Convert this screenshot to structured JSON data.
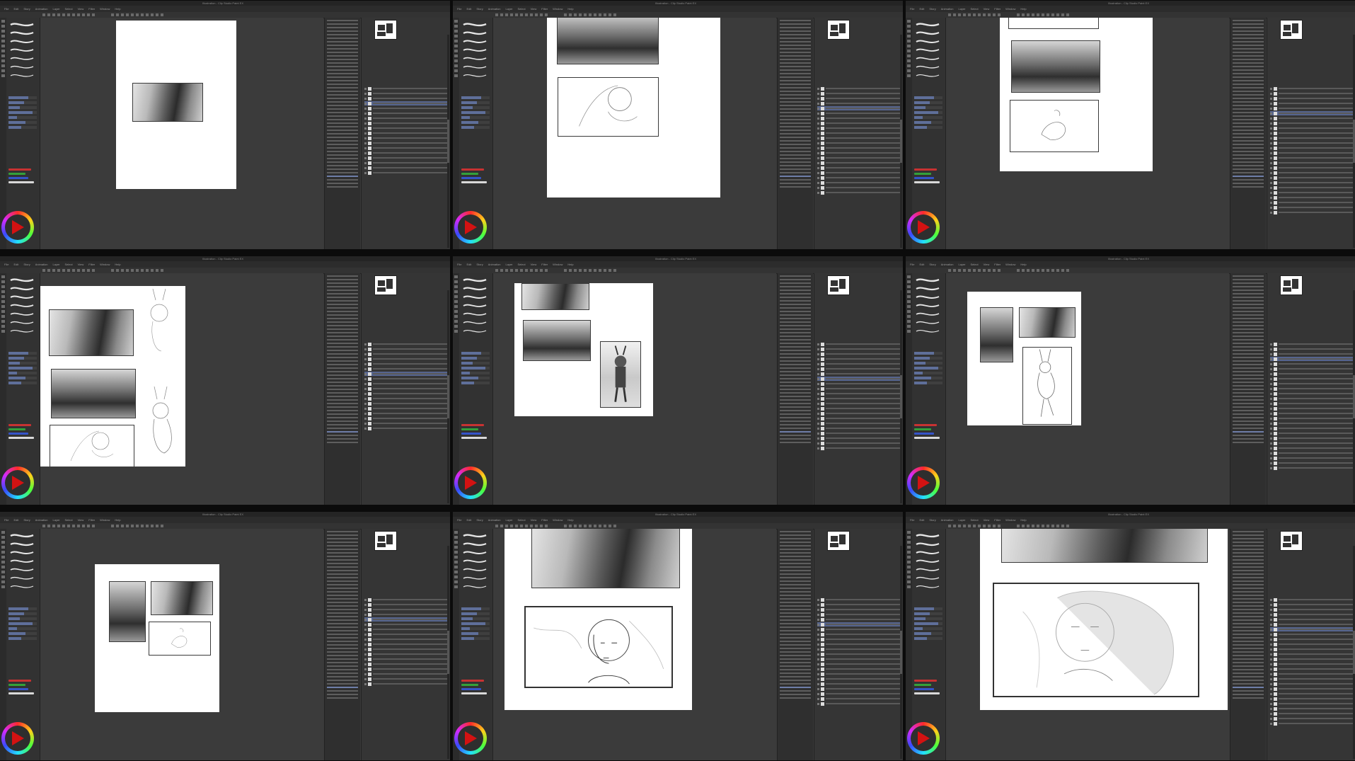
{
  "app": {
    "title": "Illustration - Clip Studio Paint EX",
    "menus": [
      "File",
      "Edit",
      "Story",
      "Animation",
      "Layer",
      "Select",
      "View",
      "Filter",
      "Window",
      "Help"
    ]
  },
  "frames": [
    {
      "id": 1,
      "scene": "page-one-panel"
    },
    {
      "id": 2,
      "scene": "zoom-top-panels"
    },
    {
      "id": 3,
      "scene": "zoom-three-panels"
    },
    {
      "id": 4,
      "scene": "wide-page-sketches"
    },
    {
      "id": 5,
      "scene": "page-with-figure"
    },
    {
      "id": 6,
      "scene": "page-three-panels"
    },
    {
      "id": 7,
      "scene": "page-final-layout"
    },
    {
      "id": 8,
      "scene": "close-up-character"
    },
    {
      "id": 9,
      "scene": "close-up-face"
    }
  ],
  "icons": {
    "color_wheel": "color-wheel-icon",
    "play": "play-icon",
    "navigator": "navigator-thumbnail",
    "visibility": "eye-icon"
  },
  "colors": {
    "accent_selection": "#55648e",
    "background": "#3b3b3b",
    "wheel_triangle": "#d31212"
  }
}
